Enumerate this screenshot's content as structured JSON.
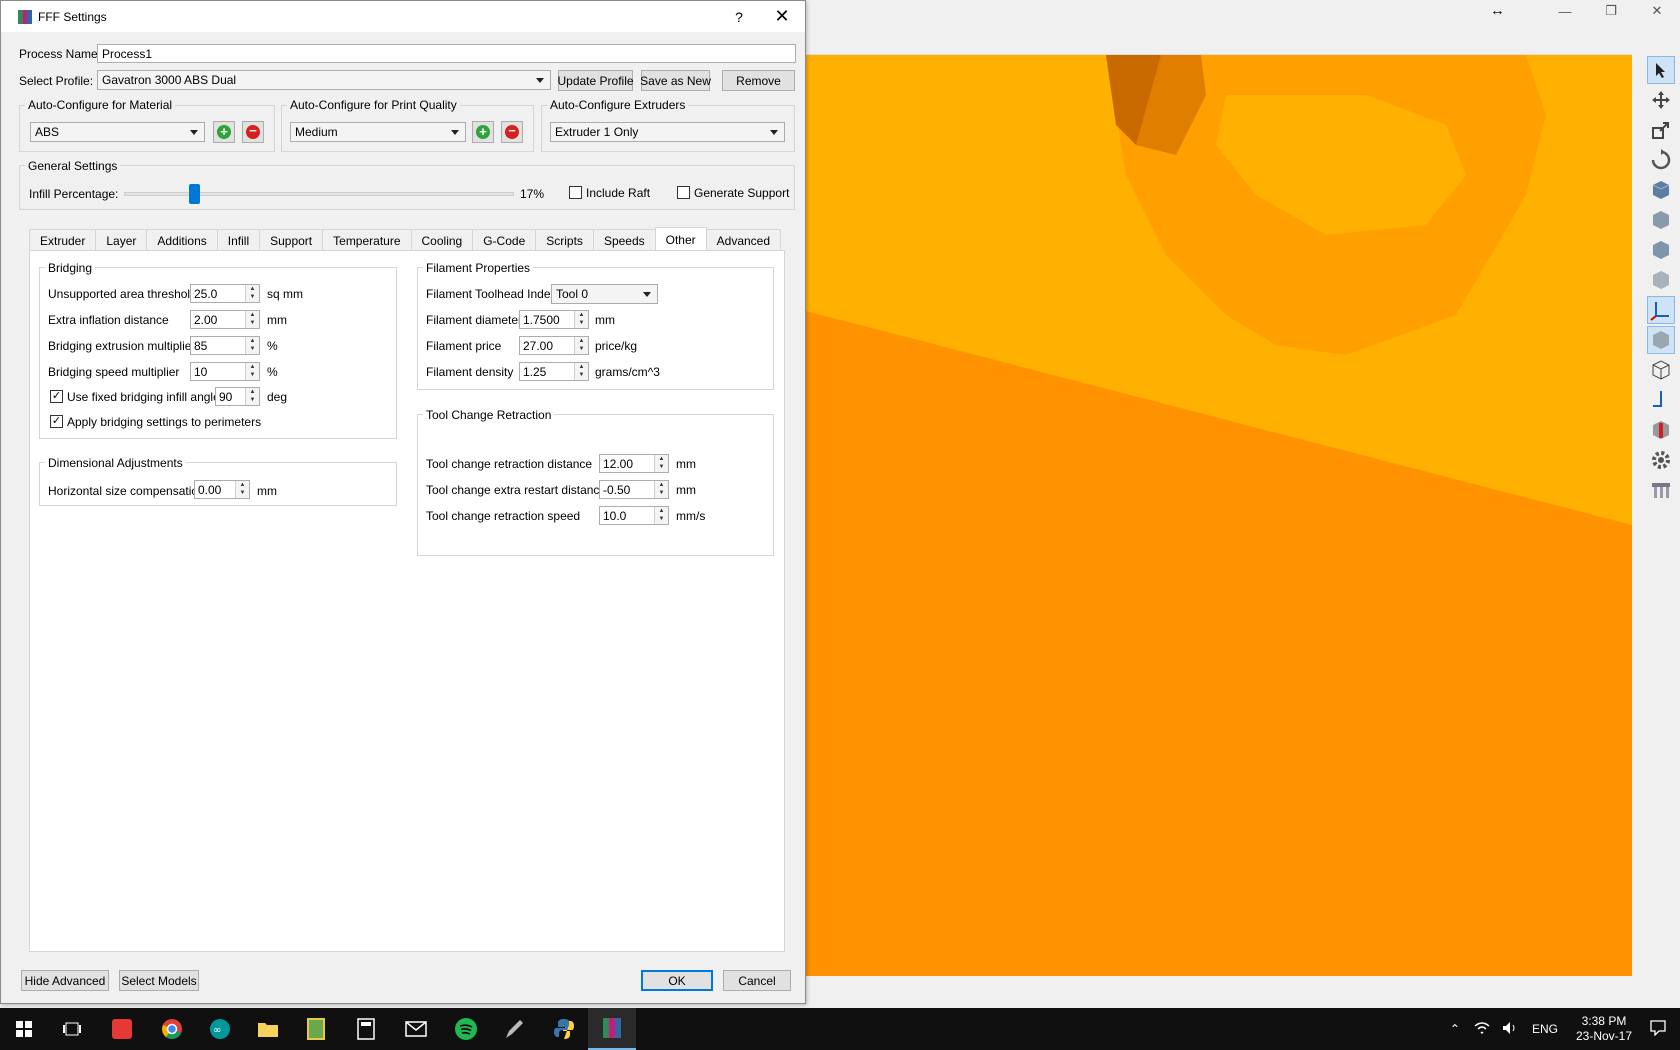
{
  "dialog": {
    "title": "FFF Settings",
    "help": "?",
    "close": "✕",
    "process_name_label": "Process Name:",
    "process_name_value": "Process1",
    "select_profile_label": "Select Profile:",
    "select_profile_value": "Gavatron 3000 ABS Dual",
    "update_profile": "Update Profile",
    "save_as_new": "Save as New",
    "remove": "Remove",
    "auto_material": {
      "title": "Auto-Configure for Material",
      "value": "ABS"
    },
    "auto_quality": {
      "title": "Auto-Configure for Print Quality",
      "value": "Medium"
    },
    "auto_extruders": {
      "title": "Auto-Configure Extruders",
      "value": "Extruder 1 Only"
    },
    "general": {
      "title": "General Settings",
      "infill_label": "Infill Percentage:",
      "infill_value": "17%",
      "infill_fraction": 0.17,
      "include_raft": "Include Raft",
      "generate_support": "Generate Support"
    },
    "tabs": [
      "Extruder",
      "Layer",
      "Additions",
      "Infill",
      "Support",
      "Temperature",
      "Cooling",
      "G-Code",
      "Scripts",
      "Speeds",
      "Other",
      "Advanced"
    ],
    "active_tab": "Other",
    "bridging": {
      "title": "Bridging",
      "unsupported_label": "Unsupported area threshold",
      "unsupported_value": "25.0",
      "unsupported_unit": "sq mm",
      "inflation_label": "Extra inflation distance",
      "inflation_value": "2.00",
      "inflation_unit": "mm",
      "extrusion_label": "Bridging extrusion multiplier",
      "extrusion_value": "85",
      "extrusion_unit": "%",
      "speed_label": "Bridging speed multiplier",
      "speed_value": "10",
      "speed_unit": "%",
      "fixed_angle_label": "Use fixed bridging infill angle",
      "fixed_angle_value": "90",
      "fixed_angle_unit": "deg",
      "apply_perimeters_label": "Apply bridging settings to perimeters"
    },
    "dimensional": {
      "title": "Dimensional Adjustments",
      "hsc_label": "Horizontal size compensation",
      "hsc_value": "0.00",
      "hsc_unit": "mm"
    },
    "filament": {
      "title": "Filament Properties",
      "toolhead_label": "Filament Toolhead Index",
      "toolhead_value": "Tool 0",
      "diameter_label": "Filament diameter",
      "diameter_value": "1.7500",
      "diameter_unit": "mm",
      "price_label": "Filament price",
      "price_value": "27.00",
      "price_unit": "price/kg",
      "density_label": "Filament density",
      "density_value": "1.25",
      "density_unit": "grams/cm^3"
    },
    "toolchange": {
      "title": "Tool Change Retraction",
      "dist_label": "Tool change retraction distance",
      "dist_value": "12.00",
      "dist_unit": "mm",
      "restart_label": "Tool change extra restart distance",
      "restart_value": "-0.50",
      "restart_unit": "mm",
      "speed_label": "Tool change retraction speed",
      "speed_value": "10.0",
      "speed_unit": "mm/s"
    },
    "hide_advanced": "Hide Advanced",
    "select_models": "Select Models",
    "ok": "OK",
    "cancel": "Cancel"
  },
  "taskbar": {
    "lang": "ENG",
    "time": "3:38 PM",
    "date": "23-Nov-17"
  },
  "colors": {
    "viewport": "#ffa800",
    "model": "#ff9000",
    "accent": "#0078d7"
  }
}
